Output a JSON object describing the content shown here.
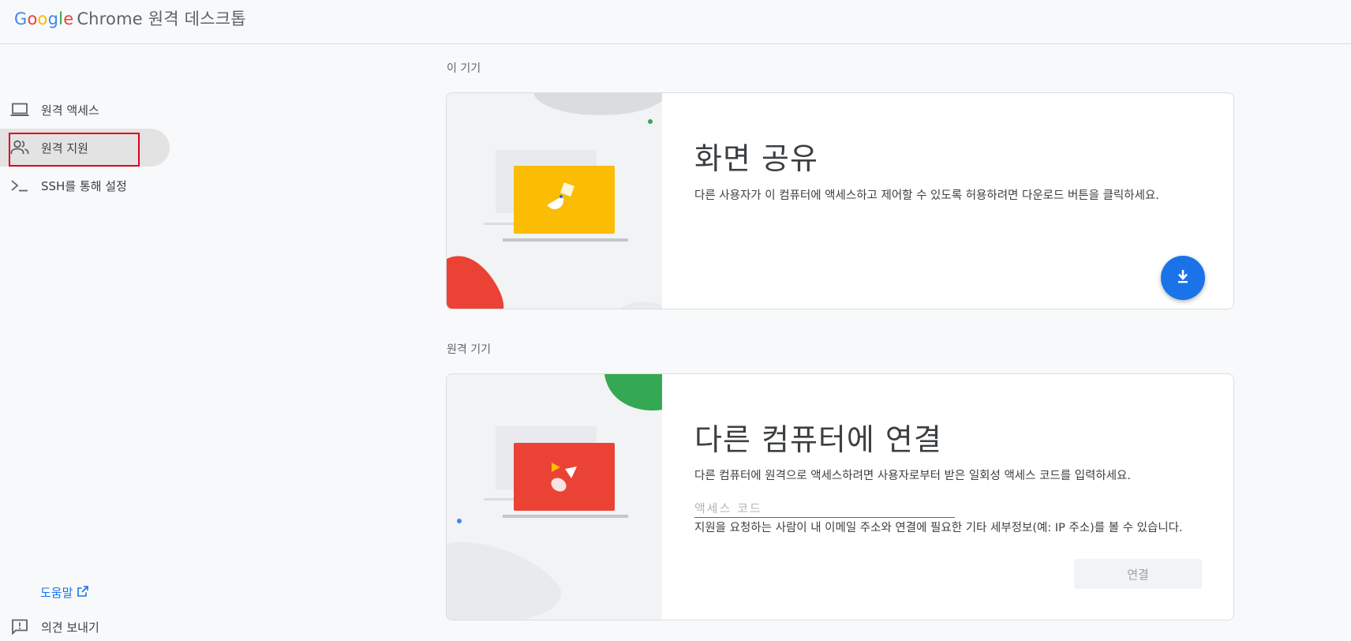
{
  "header": {
    "brand_google": [
      "G",
      "o",
      "o",
      "g",
      "l",
      "e"
    ],
    "brand_rest": "Chrome 원격 데스크톱"
  },
  "sidebar": {
    "items": [
      {
        "label": "원격 액세스",
        "icon": "laptop-icon"
      },
      {
        "label": "원격 지원",
        "icon": "people-icon",
        "active": true
      },
      {
        "label": "SSH를 통해 설정",
        "icon": "terminal-icon"
      }
    ],
    "help": "도움말",
    "feedback": "의견 보내기"
  },
  "this_device": {
    "section_title": "이 기기",
    "title": "화면 공유",
    "description": "다른 사용자가 이 컴퓨터에 액세스하고 제어할 수 있도록 허용하려면 다운로드 버튼을 클릭하세요.",
    "button_icon": "download-icon"
  },
  "remote_device": {
    "section_title": "원격 기기",
    "title": "다른 컴퓨터에 연결",
    "description": "다른 컴퓨터에 원격으로 액세스하려면 사용자로부터 받은 일회성 액세스 코드를 입력하세요.",
    "input_placeholder": "액세스 코드",
    "input_value": "",
    "helper": "지원을 요청하는 사람이 내 이메일 주소와 연결에 필요한 기타 세부정보(예: IP 주소)를 볼 수 있습니다.",
    "connect_label": "연결"
  },
  "colors": {
    "accent": "#1a73e8",
    "yellow": "#fbbc04",
    "red": "#ea4335",
    "green": "#34a853",
    "highlight_box": "#e0001b"
  }
}
